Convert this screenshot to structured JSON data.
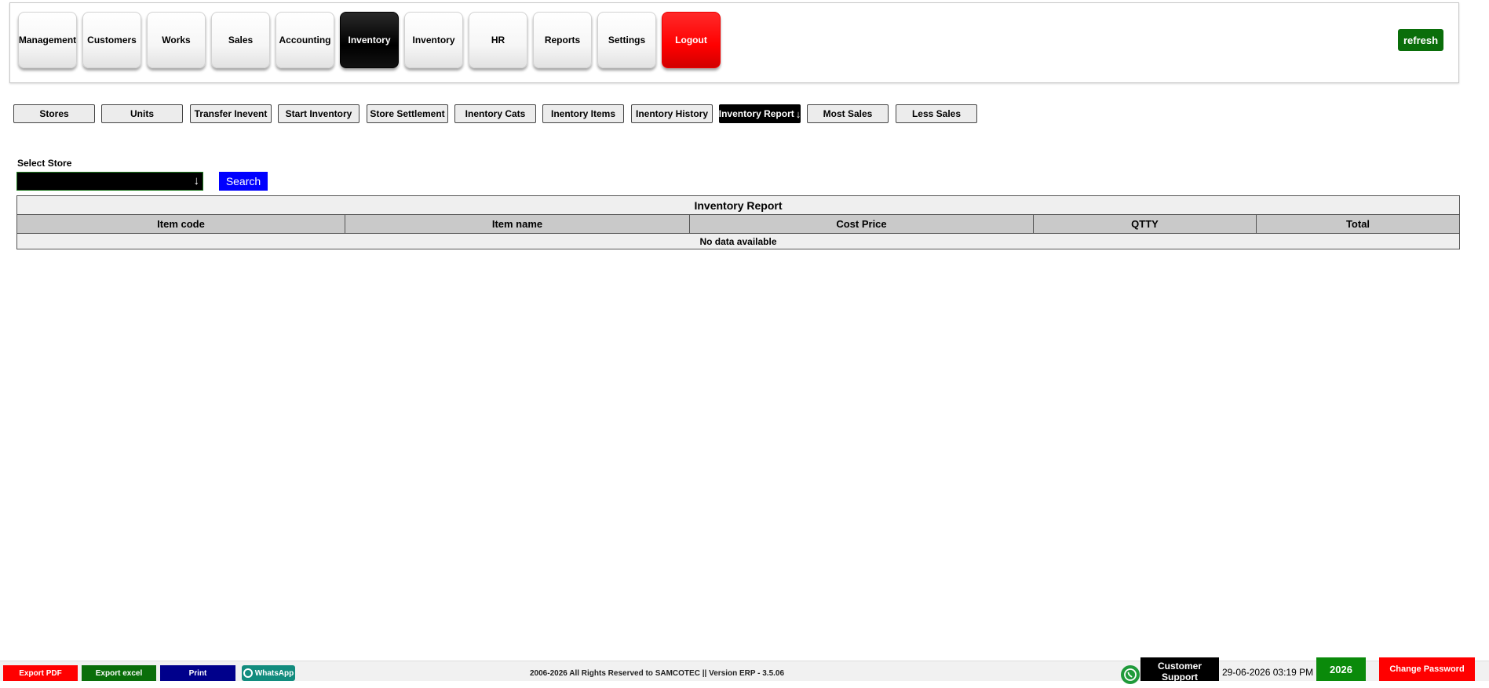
{
  "top_nav": {
    "items": [
      {
        "label": "Management"
      },
      {
        "label": "Customers"
      },
      {
        "label": "Works"
      },
      {
        "label": "Sales"
      },
      {
        "label": "Accounting"
      },
      {
        "label": "Inventory",
        "active": true
      },
      {
        "label": "Inventory"
      },
      {
        "label": "HR"
      },
      {
        "label": "Reports"
      },
      {
        "label": "Settings"
      },
      {
        "label": "Logout"
      }
    ],
    "refresh_label": "refresh"
  },
  "sub_nav": {
    "items": [
      {
        "label": "Stores"
      },
      {
        "label": "Units"
      },
      {
        "label": "Transfer Inevent"
      },
      {
        "label": "Start Inventory"
      },
      {
        "label": "Store Settlement"
      },
      {
        "label": "Inentory Cats"
      },
      {
        "label": "Inentory Items"
      },
      {
        "label": "Inentory History"
      },
      {
        "label": "Inventory Report",
        "active": true
      },
      {
        "label": "Most Sales"
      },
      {
        "label": "Less Sales"
      }
    ]
  },
  "filter": {
    "store_label": "Select Store",
    "store_value": "",
    "search_label": "Search"
  },
  "report": {
    "title": "Inventory Report",
    "columns": [
      "Item code",
      "Item name",
      "Cost Price",
      "QTTY",
      "Total"
    ],
    "empty_text": "No data available"
  },
  "footer": {
    "export_pdf": "Export PDF",
    "export_excel": "Export excel",
    "print": "Print",
    "whatsapp": "WhatsApp",
    "copyright": "2006-2026 All Rights Reserved to SAMCOTEC || Version ERP - 3.5.06",
    "support": "Customer Support",
    "datetime": "29-06-2026 03:19 PM",
    "year": "2026",
    "change_password": "Change Password"
  },
  "colors": {
    "active": "#000000",
    "logout": "#ff0000",
    "refresh": "#0a6e0a",
    "search": "#0000ff",
    "export_pdf": "#ff0000",
    "export_excel": "#0a6e0a",
    "print": "#00008b",
    "whatsapp": "#128c7e"
  }
}
